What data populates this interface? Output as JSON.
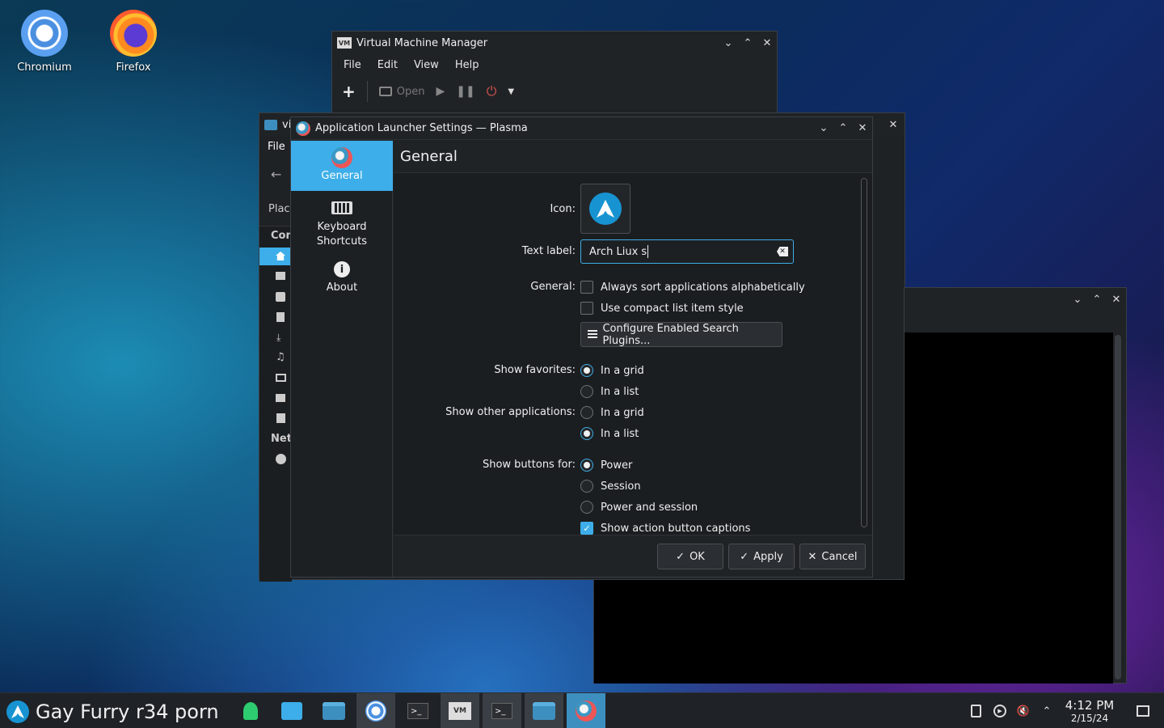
{
  "desktop": {
    "icons": [
      {
        "label": "Chromium"
      },
      {
        "label": "Firefox"
      }
    ]
  },
  "vmm": {
    "title": "Virtual Machine Manager",
    "menu": [
      "File",
      "Edit",
      "View",
      "Help"
    ],
    "toolbar": {
      "open_label": "Open"
    }
  },
  "filemgr": {
    "title_fragment": "vi",
    "menu_file": "File",
    "places_label": "Place",
    "computer_label": "Com",
    "network_label": "Net"
  },
  "dialog": {
    "title": "Application Launcher Settings — Plasma",
    "sidebar": [
      {
        "label": "General"
      },
      {
        "label": "Keyboard Shortcuts"
      },
      {
        "label": "About"
      }
    ],
    "heading": "General",
    "icon_label": "Icon:",
    "text_label_label": "Text label:",
    "text_label_value": "Arch Liux s",
    "general_label": "General:",
    "always_sort": "Always sort applications alphabetically",
    "compact_list": "Use compact list item style",
    "configure_plugins": "Configure Enabled Search Plugins...",
    "show_favorites_label": "Show favorites:",
    "fav_grid": "In a grid",
    "fav_list": "In a list",
    "show_other_label": "Show other applications:",
    "other_grid": "In a grid",
    "other_list": "In a list",
    "show_buttons_label": "Show buttons for:",
    "btn_power": "Power",
    "btn_session": "Session",
    "btn_power_session": "Power and session",
    "show_captions": "Show action button captions",
    "ok": "OK",
    "apply": "Apply",
    "cancel": "Cancel"
  },
  "taskbar": {
    "launcher_text": "Gay Furry r34 porn",
    "clock_time": "4:12 PM",
    "clock_date": "2/15/24"
  },
  "colors": {
    "accent": "#3daee9",
    "window_bg": "#202326",
    "content_bg": "#1b1e20"
  }
}
